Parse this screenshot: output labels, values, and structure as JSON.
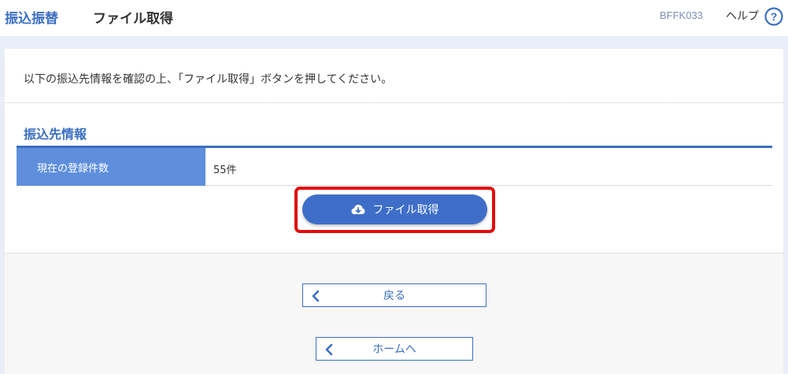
{
  "header": {
    "section": "振込振替",
    "title": "ファイル取得",
    "screen_id": "BFFK033",
    "help_label": "ヘルプ",
    "help_icon_glyph": "?"
  },
  "instruction": "以下の振込先情報を確認の上、「ファイル取得」ボタンを押してください。",
  "section": {
    "title": "振込先情報",
    "rows": [
      {
        "label": "現在の登録件数",
        "value": "55件"
      }
    ]
  },
  "buttons": {
    "file_get": "ファイル取得",
    "back": "戻る",
    "home": "ホームへ"
  },
  "icons": {
    "help": "help-circle-icon",
    "download": "cloud-download-icon",
    "back": "chevron-left-icon",
    "home": "chevron-left-icon"
  },
  "colors": {
    "brand_blue": "#3b6fc2",
    "table_header": "#5f8fdc",
    "primary_button": "#3e6ec8",
    "highlight": "#e00d0d",
    "band": "#e8eef8"
  }
}
